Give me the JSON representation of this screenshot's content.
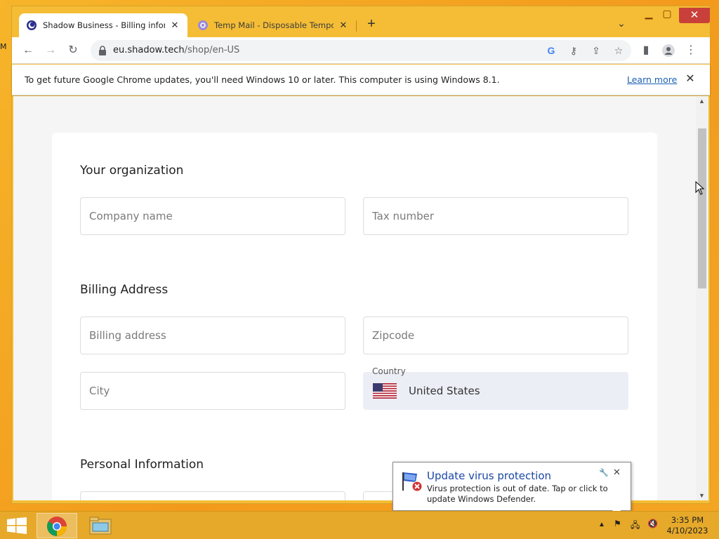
{
  "desktop": {
    "edge_text": "M"
  },
  "browser": {
    "tabs": [
      {
        "title": "Shadow Business - Billing inform",
        "favicon": "shadow-icon",
        "active": true
      },
      {
        "title": "Temp Mail - Disposable Tempora",
        "favicon": "tempmail-icon",
        "active": false
      }
    ],
    "url_host": "eu.shadow.tech",
    "url_path": "/shop/en-US",
    "infobar": {
      "text": "To get future Google Chrome updates, you'll need Windows 10 or later. This computer is using Windows 8.1.",
      "link": "Learn more"
    }
  },
  "form": {
    "organization_title": "Your organization",
    "company_name_placeholder": "Company name",
    "tax_number_placeholder": "Tax number",
    "billing_title": "Billing Address",
    "billing_address_placeholder": "Billing address",
    "zipcode_placeholder": "Zipcode",
    "city_placeholder": "City",
    "country_label": "Country",
    "country_value": "United States",
    "personal_title": "Personal Information"
  },
  "notification": {
    "title": "Update virus protection",
    "body": "Virus protection is out of date. Tap or click to update Windows Defender."
  },
  "taskbar": {
    "time": "3:35 PM",
    "date": "4/10/2023"
  },
  "colors": {
    "desktop_bg": "#f4a623",
    "link": "#1a5fb4",
    "country_bg": "#eceef6",
    "notification_title": "#1a47a6"
  }
}
